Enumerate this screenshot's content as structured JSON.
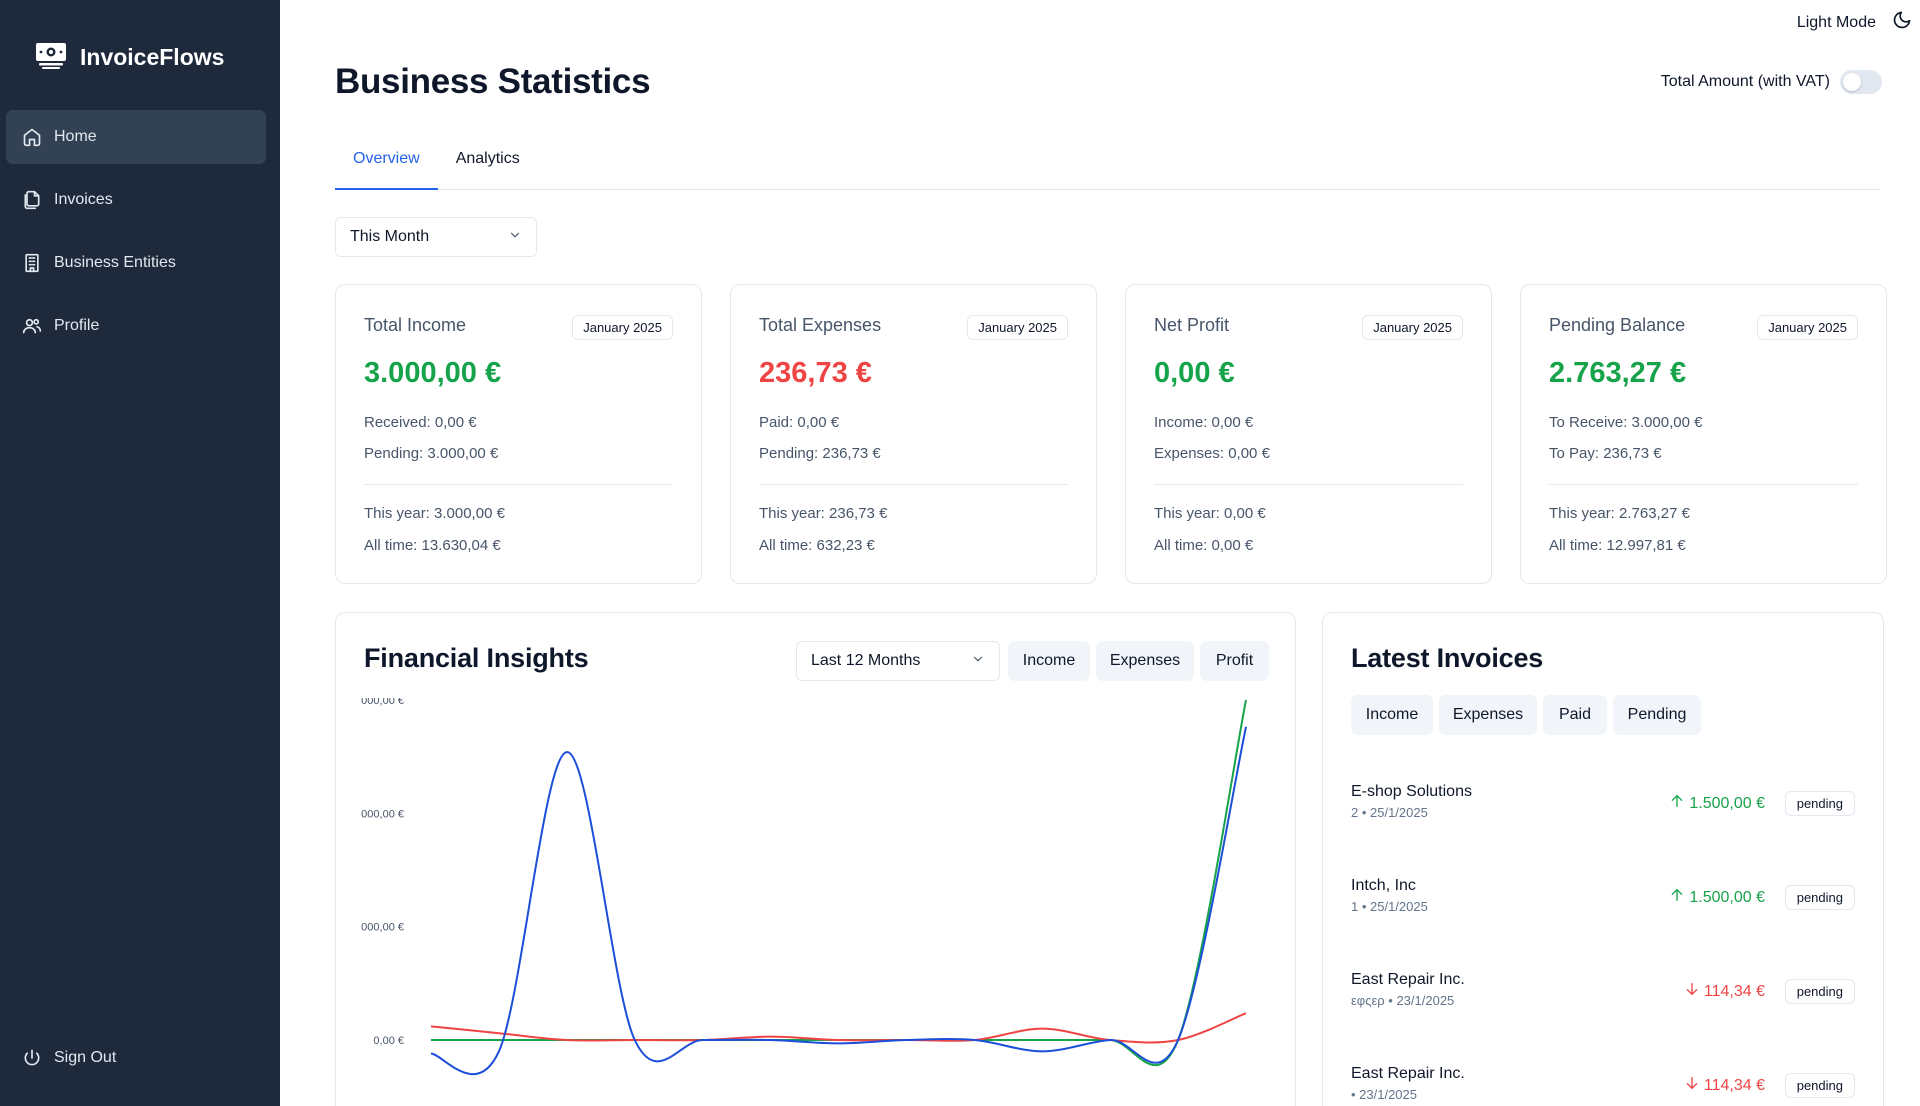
{
  "app": {
    "name": "InvoiceFlows"
  },
  "sidebar": {
    "items": [
      {
        "label": "Home",
        "icon": "home-icon"
      },
      {
        "label": "Invoices",
        "icon": "files-icon"
      },
      {
        "label": "Business Entities",
        "icon": "building-icon"
      },
      {
        "label": "Profile",
        "icon": "users-icon"
      }
    ],
    "signout_label": "Sign Out"
  },
  "header": {
    "mode_label": "Light Mode",
    "title": "Business Statistics",
    "vat_label": "Total Amount (with VAT)",
    "vat_enabled": false
  },
  "tabs": [
    {
      "label": "Overview"
    },
    {
      "label": "Analytics"
    }
  ],
  "period_select": {
    "value": "This Month"
  },
  "cards": [
    {
      "title": "Total Income",
      "badge": "January 2025",
      "value": "3.000,00 €",
      "line1": "Received: 0,00 €",
      "line2": "Pending: 3.000,00 €",
      "line3": "This year: 3.000,00 €",
      "line4": "All time: 13.630,04 €"
    },
    {
      "title": "Total Expenses",
      "badge": "January 2025",
      "value": "236,73 €",
      "line1": "Paid: 0,00 €",
      "line2": "Pending: 236,73 €",
      "line3": "This year: 236,73 €",
      "line4": "All time: 632,23 €"
    },
    {
      "title": "Net Profit",
      "badge": "January 2025",
      "value": "0,00 €",
      "line1": "Income: 0,00 €",
      "line2": "Expenses: 0,00 €",
      "line3": "This year: 0,00 €",
      "line4": "All time: 0,00 €"
    },
    {
      "title": "Pending Balance",
      "badge": "January 2025",
      "value": "2.763,27 €",
      "line1": "To Receive: 3.000,00 €",
      "line2": "To Pay: 236,73 €",
      "line3": "This year: 2.763,27 €",
      "line4": "All time: 12.997,81 €"
    }
  ],
  "insights": {
    "title": "Financial Insights",
    "range_select": "Last 12 Months",
    "filters": [
      "Income",
      "Expenses",
      "Profit"
    ]
  },
  "chart_data": {
    "type": "line",
    "y_tick_labels": [
      "000,00 €",
      "000,00 €",
      "000,00 €",
      "0,00 €"
    ],
    "y_ticks": [
      3000,
      2000,
      1000,
      0
    ],
    "ylim": [
      0,
      3000
    ],
    "x_count": 13,
    "series": [
      {
        "color": "#16a34a",
        "values": [
          0,
          0,
          0,
          0,
          0,
          0,
          0,
          0,
          0,
          0,
          0,
          0,
          3000
        ]
      },
      {
        "color": "#ef4444",
        "values": [
          120,
          60,
          0,
          0,
          0,
          30,
          0,
          0,
          0,
          100,
          0,
          0,
          237
        ]
      },
      {
        "color": "#1d4ed8",
        "values": [
          -120,
          -100,
          2540,
          0,
          0,
          0,
          -30,
          0,
          0,
          -100,
          0,
          0,
          2763
        ]
      }
    ]
  },
  "latest": {
    "title": "Latest Invoices",
    "filters": [
      "Income",
      "Expenses",
      "Paid",
      "Pending"
    ],
    "items": [
      {
        "name": "E-shop Solutions",
        "sub": "2 • 25/1/2025",
        "amount": "1.500,00 €",
        "direction": "up",
        "status": "pending"
      },
      {
        "name": "Intch, Inc",
        "sub": "1 • 25/1/2025",
        "amount": "1.500,00 €",
        "direction": "up",
        "status": "pending"
      },
      {
        "name": "East Repair Inc.",
        "sub": "εφςερ • 23/1/2025",
        "amount": "114,34 €",
        "direction": "down",
        "status": "pending"
      },
      {
        "name": "East Repair Inc.",
        "sub": "• 23/1/2025",
        "amount": "114,34 €",
        "direction": "down",
        "status": "pending"
      }
    ]
  },
  "colors": {
    "sidebar": "#1e293b",
    "accent": "#2563eb",
    "income": "#16a34a",
    "expense": "#ef4444"
  }
}
